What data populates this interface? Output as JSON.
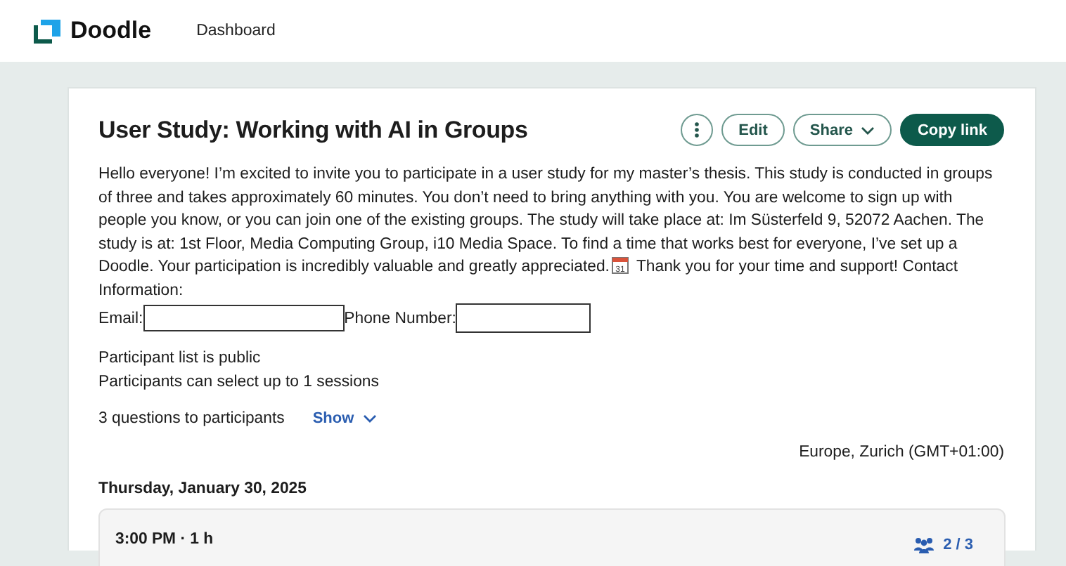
{
  "header": {
    "logo": "Doodle",
    "nav": [
      {
        "label": "Dashboard"
      }
    ]
  },
  "poll": {
    "title": "User Study: Working with AI in Groups",
    "actions": [
      {
        "kind": "more"
      },
      {
        "kind": "outline",
        "label": "Edit"
      },
      {
        "kind": "dropdown",
        "label": "Share"
      },
      {
        "kind": "primary",
        "label": "Copy link"
      }
    ],
    "description": {
      "before_icon": "Hello everyone! I’m excited to invite you to participate in a user study for my master’s thesis. This study is conducted in groups of three and takes approximately 60 minutes. You don’t need to bring anything with you. You are welcome to sign up with people you know, or you can join one of the existing groups. The study will take place at: Im Süsterfeld 9, 52072 Aachen. The study is at: 1st Floor, Media Computing Group, i10 Media Space. To find a time that works best for everyone, I’ve set up a Doodle. Your participation is incredibly valuable and greatly appreciated.",
      "icon_text": "31",
      "after_icon": "Thank you for your time and support! Contact Information:",
      "email_label": "Email:",
      "phone_label": "Phone Number:"
    },
    "settings": [
      "Participant list is public",
      "Participants can select up to 1 sessions"
    ],
    "questions": {
      "label": "3 questions to participants",
      "toggle": "Show"
    },
    "timezone": "Europe, Zurich (GMT+01:00)",
    "days": [
      {
        "date": "Thursday, January 30, 2025",
        "slots": [
          {
            "time": "3:00 PM · 1 h",
            "count": "2 / 3"
          }
        ]
      }
    ]
  }
}
